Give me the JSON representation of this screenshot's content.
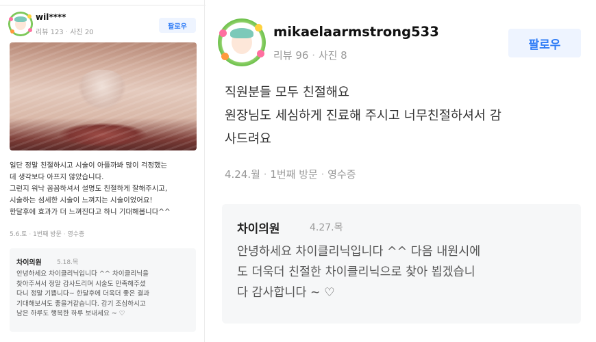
{
  "left_review": {
    "username": "wil****",
    "review_count": "리뷰 123",
    "photo_count": "사진 20",
    "follow_label": "팔로우",
    "photo_icon": "face-closeup-photo",
    "body": [
      "일단 정말 친절하시고 시술이 아플까봐 많이 걱정했는",
      "데 생각보다 아프지 않았습니다.",
      "그런지 워낙 꼼꼼하셔서 설명도 친절하게 잘해주시고,",
      "시술하는 섬세한 시술이 느껴지는 시술이었어요!",
      "한달후에 효과가 더 느껴진다고 하니 기대해봅니다^^"
    ],
    "visit_date": "5.6.토",
    "visit_count": "1번째 방문",
    "receipt": "영수증",
    "reply": {
      "name": "차이의원",
      "date": "5.18.목",
      "body": [
        "안녕하세요 차이클리닉입니다 ^^ 차이클리닉을",
        "찾아주셔서 정말 감사드리며 시술도 만족해주셨",
        "다니 정말 기쁩니다~ 한달후에 더욱더 좋은 결과",
        "기대해보셔도 좋을거같습니다. 감기 조심하시고",
        "남은 하루도 행복한 하루 보내세요 ~ ♡"
      ]
    }
  },
  "right_review": {
    "username": "mikaelaarmstrong533",
    "review_count": "리뷰 96",
    "photo_count": "사진 8",
    "follow_label": "팔로우",
    "body": [
      "직원분들 모두 친절해요",
      "원장님도 세심하게 진료해 주시고 너무친절하셔서 감",
      "사드려요"
    ],
    "visit_date": "4.24.월",
    "visit_count": "1번째 방문",
    "receipt": "영수증",
    "reply": {
      "name": "차이의원",
      "date": "4.27.목",
      "body": [
        "안녕하세요 차이클리닉입니다 ^^ 다음 내원시에",
        "도 더욱더 친절한 차이클리닉으로 찾아 뵙겠습니",
        "다 감사합니다 ~ ♡"
      ]
    }
  },
  "colors": {
    "follow_bg": "#eef4ff",
    "follow_text": "#2f7cf6",
    "reply_bg": "#f6f7f8",
    "meta_text": "#999999"
  }
}
